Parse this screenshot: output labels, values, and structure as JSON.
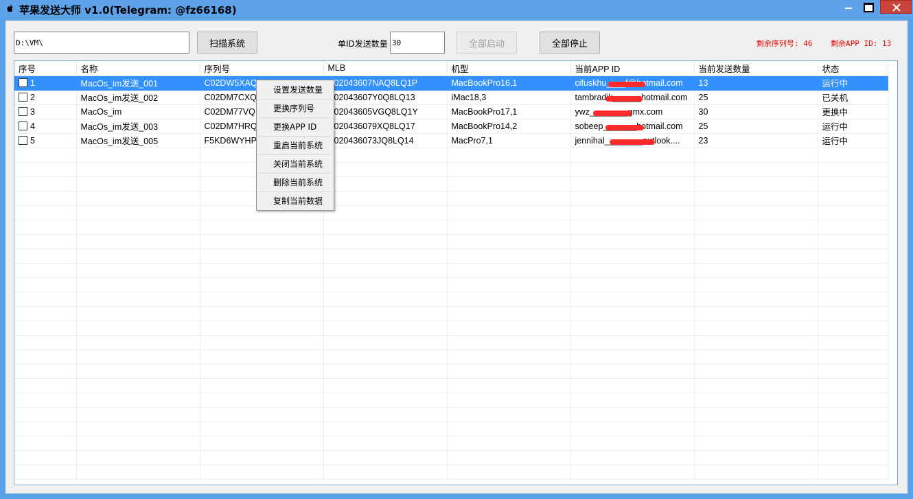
{
  "window": {
    "title": "苹果发送大师 v1.0(Telegram: @fz66168)"
  },
  "toolbar": {
    "path_value": "D:\\VM\\",
    "scan_label": "扫描系统",
    "count_label": "单ID发送数量",
    "count_value": "30",
    "start_all_label": "全部启动",
    "stop_all_label": "全部停止",
    "remaining_serial": "剩余序列号: 46",
    "remaining_appid": "剩余APP ID: 13"
  },
  "table": {
    "columns": [
      "序号",
      "名称",
      "序列号",
      "MLB",
      "机型",
      "当前APP ID",
      "当前发送数量",
      "状态"
    ],
    "rows": [
      {
        "no": "1",
        "name": "MacOs_im发送_001",
        "serial": "C02DW5XAQ",
        "mlb": "C02043607NAQ8LQ1P",
        "model": "MacBookPro16,1",
        "appid": "cifuskhu____f@hotmail.com",
        "count": "13",
        "status": "运行中",
        "selected": true
      },
      {
        "no": "2",
        "name": "MacOs_im发送_002",
        "serial": "C02DM7CXQ",
        "mlb": "C02043607Y0Q8LQ13",
        "model": "iMac18,3",
        "appid": "tambradik______hotmail.com",
        "count": "25",
        "status": "已关机",
        "selected": false
      },
      {
        "no": "3",
        "name": "MacOs_im",
        "serial": "C02DM77VQ",
        "mlb": "C02043605VGQ8LQ1Y",
        "model": "MacBookPro17,1",
        "appid": "ywz________gmx.com",
        "count": "30",
        "status": "更换中",
        "selected": false
      },
      {
        "no": "4",
        "name": "MacOs_im发送_003",
        "serial": "C02DM7HRQ",
        "mlb": "C020436079XQ8LQ17",
        "model": "MacBookPro14,2",
        "appid": "sobeep_______hotmail.com",
        "count": "25",
        "status": "运行中",
        "selected": false
      },
      {
        "no": "5",
        "name": "MacOs_im发送_005",
        "serial": "F5KD6WYHP7",
        "mlb": "C020436073JQ8LQ14",
        "model": "MacPro7,1",
        "appid": "jennihal________outlook....",
        "count": "23",
        "status": "运行中",
        "selected": false
      }
    ],
    "empty_rows": 23
  },
  "context_menu": {
    "items": [
      "设置发送数量",
      "更换序列号",
      "更换APP ID",
      "重启当前系统",
      "关闭当前系统",
      "删除当前系统",
      "复制当前数据"
    ]
  },
  "icons": {
    "app": "apple-logo-icon",
    "minimize": "minimize-icon",
    "maximize": "maximize-icon",
    "close": "close-icon"
  },
  "colors": {
    "titlebar": "#5ea3ea",
    "selection": "#3390ff",
    "stat_text": "#e60000",
    "close_button": "#c7453b"
  }
}
